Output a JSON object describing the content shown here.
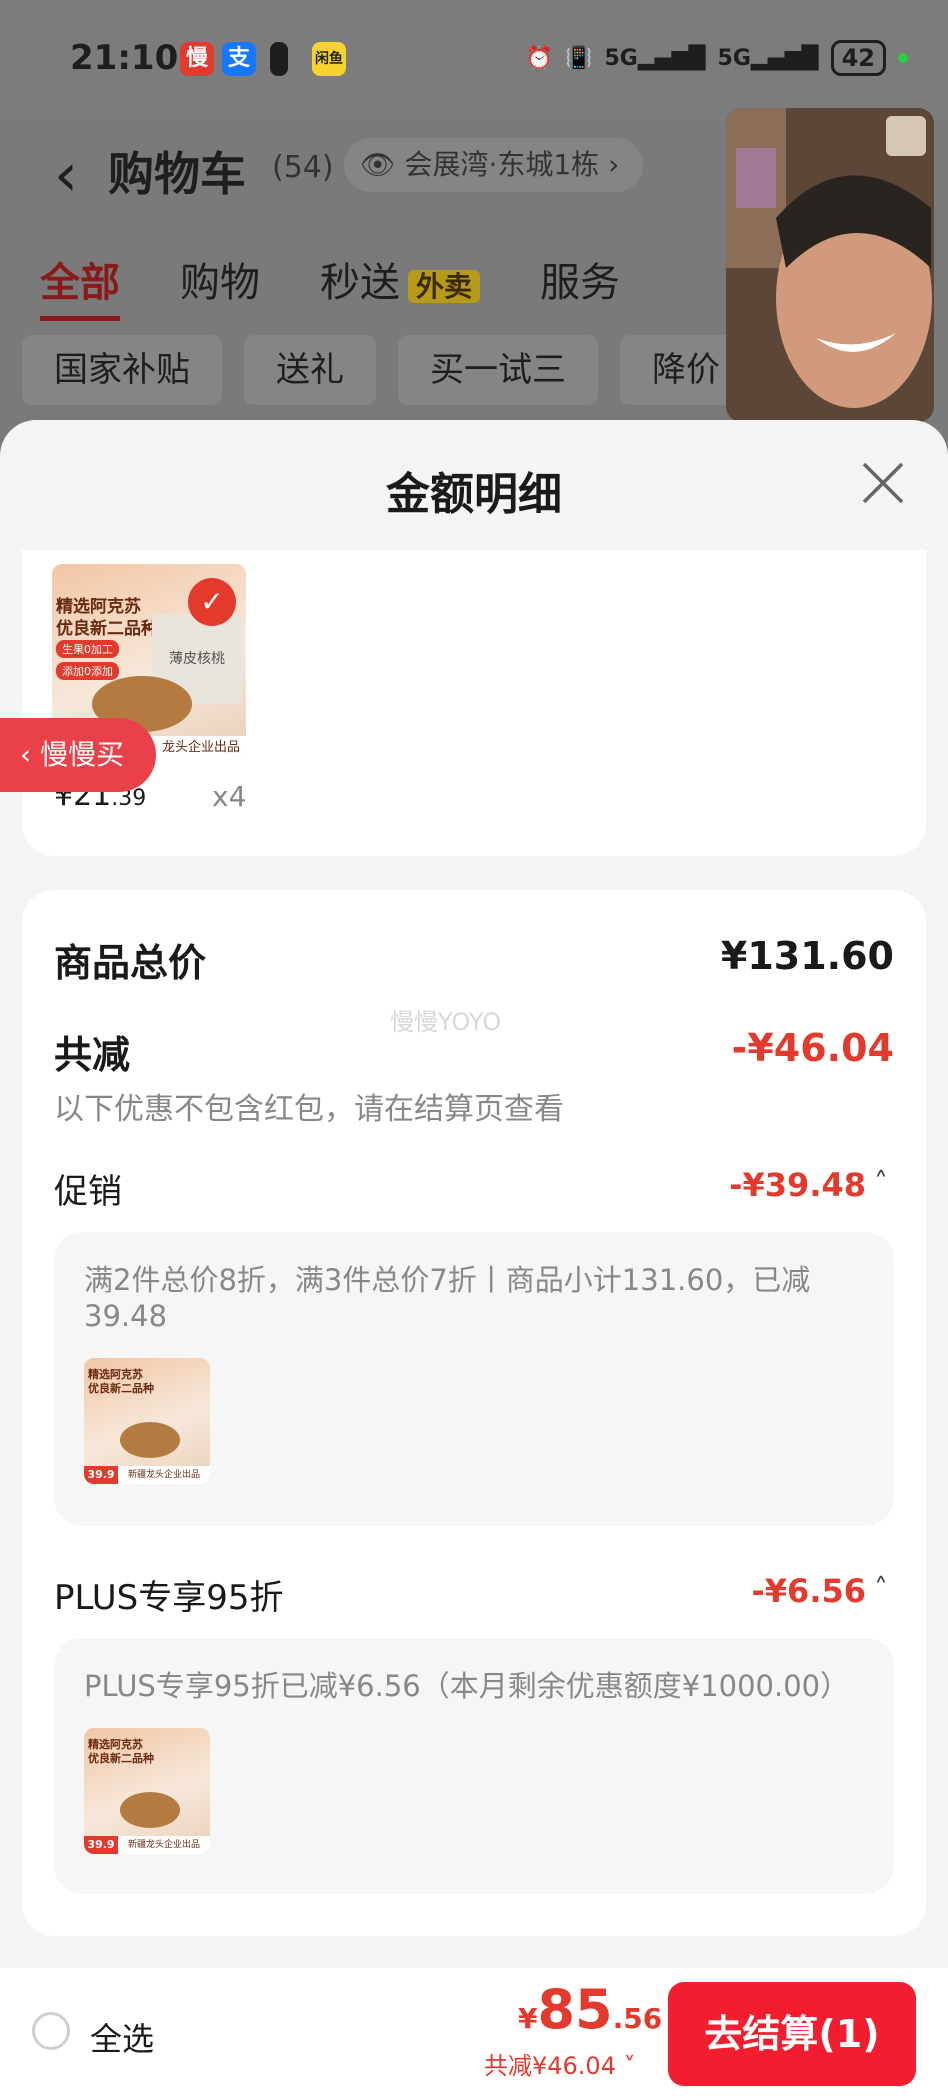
{
  "status_bar": {
    "time": "21:10",
    "app_icons": [
      "慢",
      "支",
      "▮",
      "闲鱼"
    ],
    "network": "5G",
    "battery": "42"
  },
  "header": {
    "title": "购物车",
    "count": "(54)",
    "location": "会展湾·东城1栋"
  },
  "tabs": [
    {
      "label": "全部",
      "active": true
    },
    {
      "label": "购物",
      "active": false
    },
    {
      "label": "秒送",
      "badge": "外卖",
      "active": false
    },
    {
      "label": "服务",
      "active": false
    }
  ],
  "chips": [
    "国家补贴",
    "送礼",
    "买一试三",
    "降价"
  ],
  "sheet": {
    "title": "金额明细",
    "product": {
      "price_major": "¥21",
      "price_minor": ".39",
      "qty": "x4",
      "thumb_title_1": "精选阿克苏",
      "thumb_title_2": "优良新二品种",
      "thumb_tag1": "生果0加工",
      "thumb_tag2": "添加0添加",
      "thumb_pack": "薄皮核桃",
      "thumb_footer": "龙头企业出品"
    },
    "floating_button": "慢慢买",
    "summary": {
      "total_label": "商品总价",
      "total_value": "¥131.60",
      "reduce_label": "共减",
      "reduce_value": "-¥46.04",
      "reduce_note": "以下优惠不包含红包，请在结算页查看",
      "watermark": "慢慢YOYO"
    },
    "promo": {
      "label": "促销",
      "value": "-¥39.48",
      "desc": "满2件总价8折，满3件总价7折丨商品小计131.60，已减39.48",
      "thumb_price": "39.9",
      "thumb_footer": "新疆龙头企业出品"
    },
    "plus": {
      "label": "PLUS专享95折",
      "value": "-¥6.56",
      "desc": "PLUS专享95折已减¥6.56（本月剩余优惠额度¥1000.00）",
      "thumb_price": "39.9",
      "thumb_footer": "新疆龙头企业出品"
    }
  },
  "bottom_bar": {
    "select_all": "全选",
    "price_symbol": "¥",
    "price_major": "85",
    "price_minor": ".56",
    "reduce_text": "共减¥46.04",
    "checkout": "去结算(1)"
  },
  "colors": {
    "accent_red": "#e23b2e",
    "button_red": "#f21d2f"
  }
}
